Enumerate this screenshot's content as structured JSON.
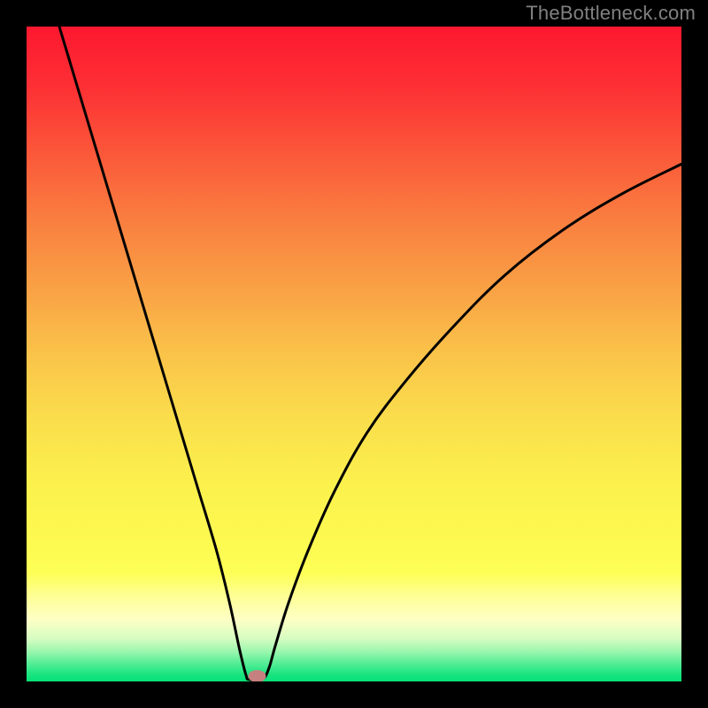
{
  "watermark": "TheBottleneck.com",
  "chart_data": {
    "type": "line",
    "title": "",
    "xlabel": "",
    "ylabel": "",
    "xlim": [
      0,
      1
    ],
    "ylim": [
      0,
      1
    ],
    "optimal_x": 0.345,
    "dot": {
      "x": 0.352,
      "y": 0.008,
      "color": "#C68080"
    },
    "curve": [
      {
        "x": 0.05,
        "y": 1.0
      },
      {
        "x": 0.08,
        "y": 0.9
      },
      {
        "x": 0.11,
        "y": 0.8
      },
      {
        "x": 0.14,
        "y": 0.7
      },
      {
        "x": 0.17,
        "y": 0.6
      },
      {
        "x": 0.2,
        "y": 0.5
      },
      {
        "x": 0.23,
        "y": 0.4
      },
      {
        "x": 0.26,
        "y": 0.3
      },
      {
        "x": 0.29,
        "y": 0.2
      },
      {
        "x": 0.31,
        "y": 0.12
      },
      {
        "x": 0.325,
        "y": 0.05
      },
      {
        "x": 0.335,
        "y": 0.01
      },
      {
        "x": 0.34,
        "y": 0.003
      },
      {
        "x": 0.36,
        "y": 0.003
      },
      {
        "x": 0.37,
        "y": 0.02
      },
      {
        "x": 0.38,
        "y": 0.055
      },
      {
        "x": 0.4,
        "y": 0.12
      },
      {
        "x": 0.43,
        "y": 0.2
      },
      {
        "x": 0.47,
        "y": 0.29
      },
      {
        "x": 0.52,
        "y": 0.38
      },
      {
        "x": 0.58,
        "y": 0.46
      },
      {
        "x": 0.65,
        "y": 0.54
      },
      {
        "x": 0.73,
        "y": 0.62
      },
      {
        "x": 0.82,
        "y": 0.69
      },
      {
        "x": 0.91,
        "y": 0.745
      },
      {
        "x": 1.0,
        "y": 0.79
      }
    ],
    "gradient_stops": [
      {
        "offset": 0.0,
        "color": "#fd1830"
      },
      {
        "offset": 0.09,
        "color": "#fd2f34"
      },
      {
        "offset": 0.2,
        "color": "#fb5a3a"
      },
      {
        "offset": 0.3,
        "color": "#f98040"
      },
      {
        "offset": 0.4,
        "color": "#f9a145"
      },
      {
        "offset": 0.5,
        "color": "#fac349"
      },
      {
        "offset": 0.6,
        "color": "#fade4c"
      },
      {
        "offset": 0.7,
        "color": "#fcf14d"
      },
      {
        "offset": 0.79,
        "color": "#fdfa51"
      },
      {
        "offset": 0.835,
        "color": "#fdff57"
      },
      {
        "offset": 0.87,
        "color": "#feff95"
      },
      {
        "offset": 0.905,
        "color": "#feffc5"
      },
      {
        "offset": 0.935,
        "color": "#d5fcc1"
      },
      {
        "offset": 0.955,
        "color": "#98f6ad"
      },
      {
        "offset": 0.975,
        "color": "#4bec92"
      },
      {
        "offset": 0.99,
        "color": "#17e47f"
      },
      {
        "offset": 1.0,
        "color": "#06e179"
      }
    ]
  }
}
